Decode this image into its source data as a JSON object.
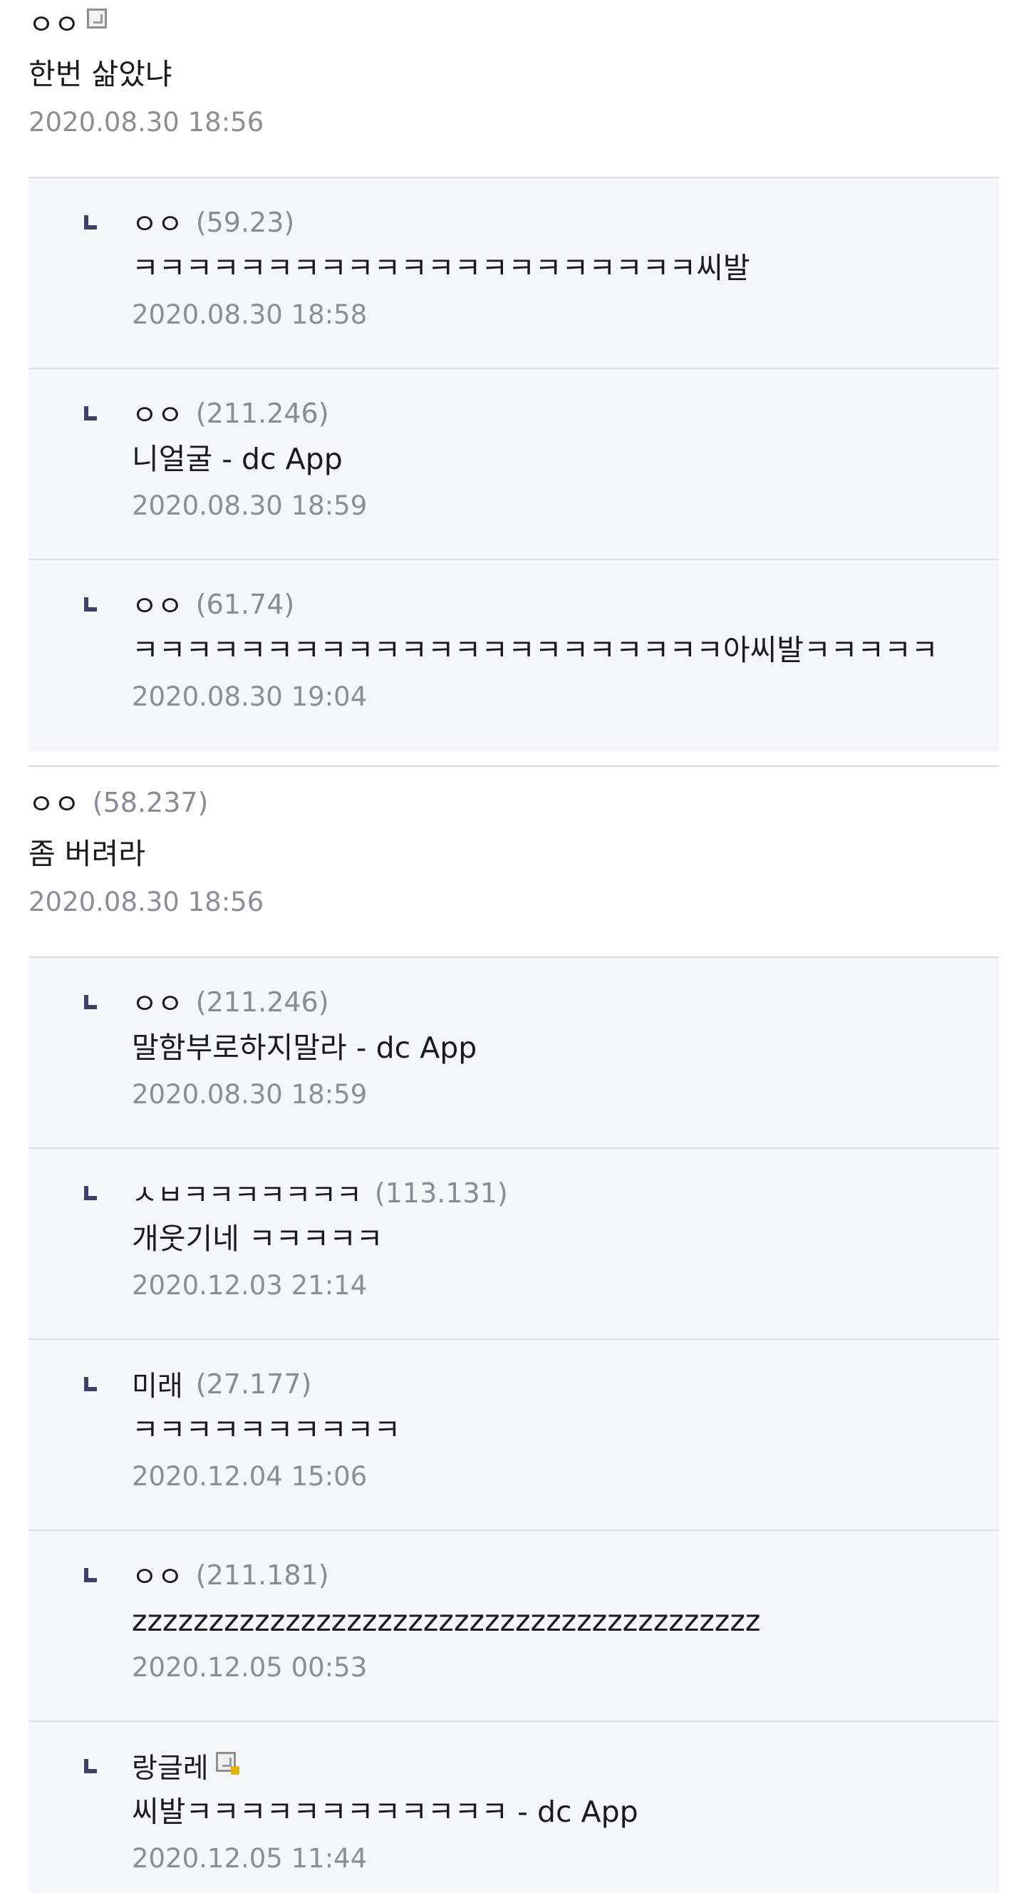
{
  "comments": [
    {
      "nick": "ㅇㅇ",
      "ip": "",
      "has_gall_icon": true,
      "body": "한번 삶았냐",
      "date": "2020.08.30 18:56",
      "replies": [
        {
          "nick": "ㅇㅇ",
          "ip": "(59.23)",
          "body": "ㅋㅋㅋㅋㅋㅋㅋㅋㅋㅋㅋㅋㅋㅋㅋㅋㅋㅋㅋㅋㅋ씨발",
          "date": "2020.08.30 18:58"
        },
        {
          "nick": "ㅇㅇ",
          "ip": "(211.246)",
          "body": "니얼굴 - dc App",
          "date": "2020.08.30 18:59"
        },
        {
          "nick": "ㅇㅇ",
          "ip": "(61.74)",
          "body": "ㅋㅋㅋㅋㅋㅋㅋㅋㅋㅋㅋㅋㅋㅋㅋㅋㅋㅋㅋㅋㅋㅋ아씨발ㅋㅋㅋㅋㅋ",
          "date": "2020.08.30 19:04"
        }
      ]
    },
    {
      "nick": "ㅇㅇ",
      "ip": "(58.237)",
      "has_gall_icon": false,
      "body": "좀 버려라",
      "date": "2020.08.30 18:56",
      "replies": [
        {
          "nick": "ㅇㅇ",
          "ip": "(211.246)",
          "body": "말함부로하지말라 - dc App",
          "date": "2020.08.30 18:59"
        },
        {
          "nick": "ㅅㅂㅋㅋㅋㅋㅋㅋㅋ",
          "ip": "(113.131)",
          "body": "개웃기네 ㅋㅋㅋㅋㅋ",
          "date": "2020.12.03 21:14"
        },
        {
          "nick": "미래",
          "ip": "(27.177)",
          "body": "ㅋㅋㅋㅋㅋㅋㅋㅋㅋㅋ",
          "date": "2020.12.04 15:06"
        },
        {
          "nick": "ㅇㅇ",
          "ip": "(211.181)",
          "body": "zzzzzzzzzzzzzzzzzzzzzzzzzzzzzzzzzzzzzzzzz",
          "date": "2020.12.05 00:53"
        },
        {
          "nick": "랑글레",
          "ip": "",
          "has_fixed_icon": true,
          "body": "씨발ㅋㅋㅋㅋㅋㅋㅋㅋㅋㅋㅋㅋ - dc App",
          "date": "2020.12.05 11:44"
        }
      ]
    }
  ]
}
